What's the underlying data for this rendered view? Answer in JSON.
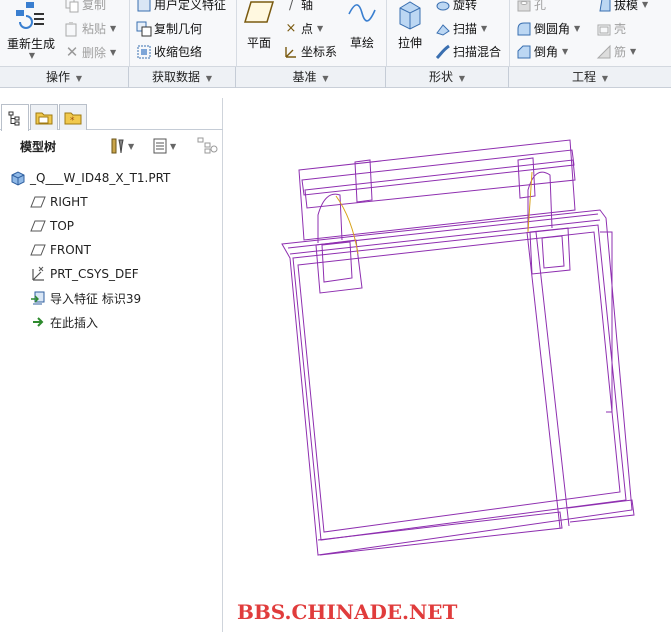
{
  "ribbon": {
    "regenerate": "重新生成",
    "copy": "复制",
    "paste": "粘贴",
    "delete": "删除",
    "user_defined_feature": "用户定义特征",
    "copy_geometry": "复制几何",
    "shrinkwrap": "收缩包络",
    "plane": "平面",
    "axis": "轴",
    "point": "点",
    "csys": "坐标系",
    "sketch": "草绘",
    "extrude": "拉伸",
    "revolve": "旋转",
    "sweep": "扫描",
    "swept_blend": "扫描混合",
    "hole": "孔",
    "round": "倒圆角",
    "chamfer": "倒角",
    "draft": "拔模",
    "shell": "壳",
    "rib": "筋"
  },
  "groups": {
    "operations": "操作",
    "get_data": "获取数据",
    "datum": "基准",
    "shapes": "形状",
    "engineering": "工程"
  },
  "model_tree": {
    "title": "模型树",
    "items": [
      {
        "label": "_Q___W_ID48_X_T1.PRT",
        "icon": "part-icon"
      },
      {
        "label": "RIGHT",
        "icon": "datum-plane-icon"
      },
      {
        "label": "TOP",
        "icon": "datum-plane-icon"
      },
      {
        "label": "FRONT",
        "icon": "datum-plane-icon"
      },
      {
        "label": "PRT_CSYS_DEF",
        "icon": "csys-icon"
      },
      {
        "label": "导入特征 标识39",
        "icon": "import-feature-icon"
      },
      {
        "label": "在此插入",
        "icon": "insert-here-arrow-icon"
      }
    ]
  },
  "watermark": "BBS.CHINADE.NET",
  "colors": {
    "wireframe": "#8e2fb0",
    "silhouette": "#d8a21a",
    "watermark": "#e03c3c",
    "insert_arrow": "#2d8a2d"
  }
}
